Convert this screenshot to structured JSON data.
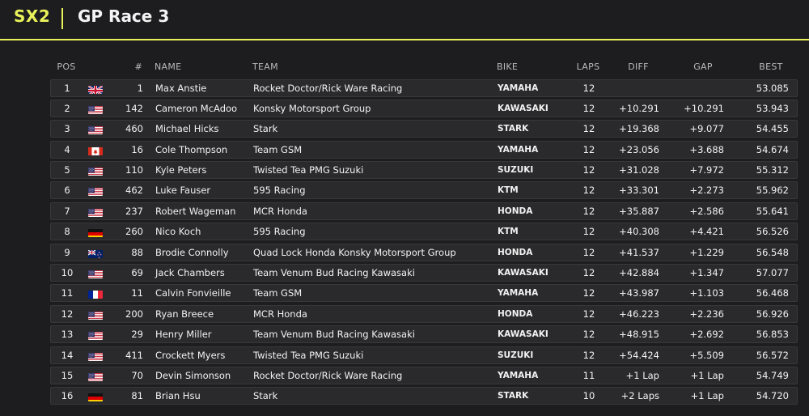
{
  "header": {
    "series": "SX2",
    "race_title": "GP Race 3"
  },
  "columns": {
    "pos": "POS",
    "num": "#",
    "name": "NAME",
    "team": "TEAM",
    "bike": "BIKE",
    "laps": "LAPS",
    "diff": "DIFF",
    "gap": "GAP",
    "best": "BEST"
  },
  "colors": {
    "accent": "#e8f05a",
    "background": "#1d1d1f",
    "row_background": "#2a2a2c"
  },
  "rows": [
    {
      "pos": "1",
      "flag": "GB",
      "num": "1",
      "name": "Max Anstie",
      "team": "Rocket Doctor/Rick Ware Racing",
      "bike": "YAMAHA",
      "laps": "12",
      "diff": "",
      "gap": "",
      "best": "53.085"
    },
    {
      "pos": "2",
      "flag": "US",
      "num": "142",
      "name": "Cameron McAdoo",
      "team": "Konsky Motorsport Group",
      "bike": "KAWASAKI",
      "laps": "12",
      "diff": "+10.291",
      "gap": "+10.291",
      "best": "53.943"
    },
    {
      "pos": "3",
      "flag": "US",
      "num": "460",
      "name": "Michael Hicks",
      "team": "Stark",
      "bike": "STARK",
      "laps": "12",
      "diff": "+19.368",
      "gap": "+9.077",
      "best": "54.455"
    },
    {
      "pos": "4",
      "flag": "CA",
      "num": "16",
      "name": "Cole Thompson",
      "team": "Team GSM",
      "bike": "YAMAHA",
      "laps": "12",
      "diff": "+23.056",
      "gap": "+3.688",
      "best": "54.674"
    },
    {
      "pos": "5",
      "flag": "US",
      "num": "110",
      "name": "Kyle Peters",
      "team": "Twisted Tea PMG Suzuki",
      "bike": "SUZUKI",
      "laps": "12",
      "diff": "+31.028",
      "gap": "+7.972",
      "best": "55.312"
    },
    {
      "pos": "6",
      "flag": "US",
      "num": "462",
      "name": "Luke Fauser",
      "team": "595 Racing",
      "bike": "KTM",
      "laps": "12",
      "diff": "+33.301",
      "gap": "+2.273",
      "best": "55.962"
    },
    {
      "pos": "7",
      "flag": "US",
      "num": "237",
      "name": "Robert Wageman",
      "team": "MCR Honda",
      "bike": "HONDA",
      "laps": "12",
      "diff": "+35.887",
      "gap": "+2.586",
      "best": "55.641"
    },
    {
      "pos": "8",
      "flag": "DE",
      "num": "260",
      "name": "Nico Koch",
      "team": "595 Racing",
      "bike": "KTM",
      "laps": "12",
      "diff": "+40.308",
      "gap": "+4.421",
      "best": "56.526"
    },
    {
      "pos": "9",
      "flag": "NZ",
      "num": "88",
      "name": "Brodie Connolly",
      "team": "Quad Lock Honda Konsky Motorsport Group",
      "bike": "HONDA",
      "laps": "12",
      "diff": "+41.537",
      "gap": "+1.229",
      "best": "56.548"
    },
    {
      "pos": "10",
      "flag": "US",
      "num": "69",
      "name": "Jack Chambers",
      "team": "Team Venum Bud Racing Kawasaki",
      "bike": "KAWASAKI",
      "laps": "12",
      "diff": "+42.884",
      "gap": "+1.347",
      "best": "57.077"
    },
    {
      "pos": "11",
      "flag": "FR",
      "num": "11",
      "name": "Calvin Fonvieille",
      "team": "Team GSM",
      "bike": "YAMAHA",
      "laps": "12",
      "diff": "+43.987",
      "gap": "+1.103",
      "best": "56.468"
    },
    {
      "pos": "12",
      "flag": "US",
      "num": "200",
      "name": "Ryan Breece",
      "team": "MCR Honda",
      "bike": "HONDA",
      "laps": "12",
      "diff": "+46.223",
      "gap": "+2.236",
      "best": "56.926"
    },
    {
      "pos": "13",
      "flag": "US",
      "num": "29",
      "name": "Henry Miller",
      "team": "Team Venum Bud Racing Kawasaki",
      "bike": "KAWASAKI",
      "laps": "12",
      "diff": "+48.915",
      "gap": "+2.692",
      "best": "56.853"
    },
    {
      "pos": "14",
      "flag": "US",
      "num": "411",
      "name": "Crockett Myers",
      "team": "Twisted Tea PMG Suzuki",
      "bike": "SUZUKI",
      "laps": "12",
      "diff": "+54.424",
      "gap": "+5.509",
      "best": "56.572"
    },
    {
      "pos": "15",
      "flag": "US",
      "num": "70",
      "name": "Devin Simonson",
      "team": "Rocket Doctor/Rick Ware Racing",
      "bike": "YAMAHA",
      "laps": "11",
      "diff": "+1 Lap",
      "gap": "+1 Lap",
      "best": "54.749"
    },
    {
      "pos": "16",
      "flag": "DE",
      "num": "81",
      "name": "Brian Hsu",
      "team": "Stark",
      "bike": "STARK",
      "laps": "10",
      "diff": "+2 Laps",
      "gap": "+1 Lap",
      "best": "54.720"
    }
  ]
}
